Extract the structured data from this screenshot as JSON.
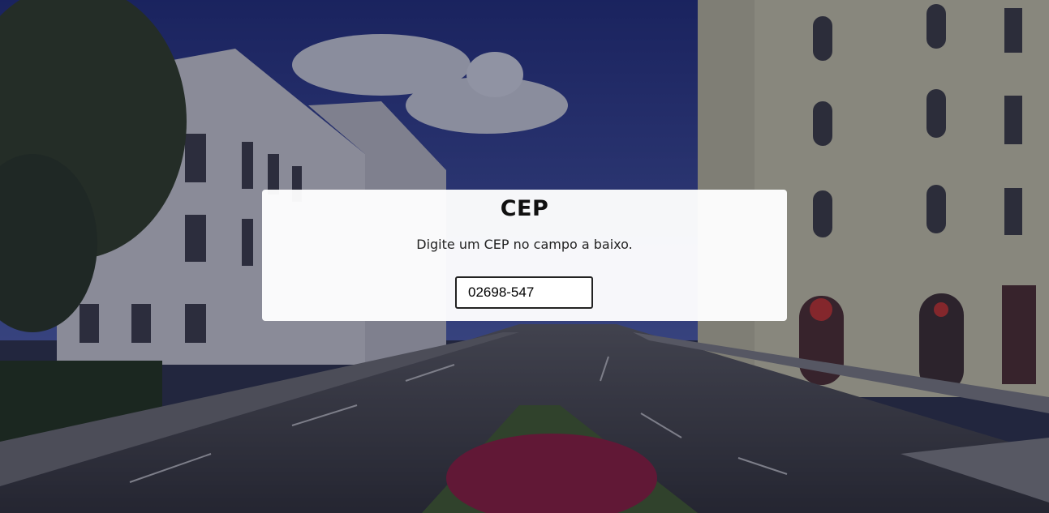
{
  "card": {
    "title": "CEP",
    "subtitle": "Digite um CEP no campo a baixo.",
    "input_value": "02698-547"
  },
  "colors": {
    "overlay": "#1c2040",
    "card_background": "#ffffff",
    "sky": "#2b3a8a"
  }
}
